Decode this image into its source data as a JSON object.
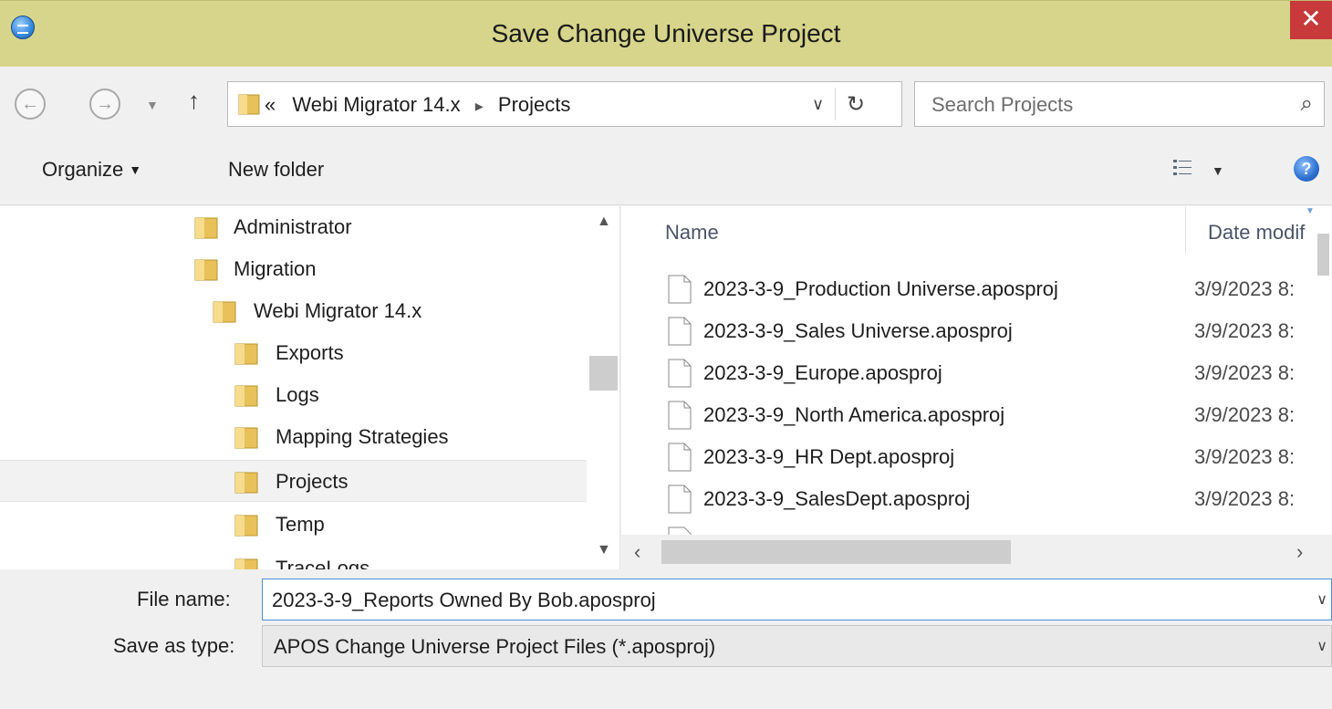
{
  "window": {
    "title": "Save Change Universe Project",
    "close_glyph": "✕"
  },
  "address_bar": {
    "prefix": "«",
    "segments": [
      "Webi Migrator 14.x",
      "Projects"
    ],
    "separator": "▸",
    "search_placeholder": "Search Projects"
  },
  "toolbar": {
    "organize_label": "Organize",
    "new_folder_label": "New folder",
    "help_glyph": "?"
  },
  "navigation_tree": {
    "items": [
      {
        "label": "Administrator",
        "level": 0,
        "selected": false
      },
      {
        "label": "Migration",
        "level": 0,
        "selected": false
      },
      {
        "label": "Webi Migrator 14.x",
        "level": 1,
        "selected": false
      },
      {
        "label": "Exports",
        "level": 2,
        "selected": false
      },
      {
        "label": "Logs",
        "level": 2,
        "selected": false
      },
      {
        "label": "Mapping Strategies",
        "level": 2,
        "selected": false
      },
      {
        "label": "Projects",
        "level": 2,
        "selected": true
      },
      {
        "label": "Temp",
        "level": 2,
        "selected": false
      },
      {
        "label": "TraceLogs",
        "level": 2,
        "selected": false
      }
    ]
  },
  "file_list": {
    "columns": [
      "Name",
      "Date modif"
    ],
    "rows": [
      {
        "name": "2023-3-9_Production Universe.aposproj",
        "date": "3/9/2023 8:"
      },
      {
        "name": "2023-3-9_Sales Universe.aposproj",
        "date": "3/9/2023 8:"
      },
      {
        "name": "2023-3-9_Europe.aposproj",
        "date": "3/9/2023 8:"
      },
      {
        "name": "2023-3-9_North America.aposproj",
        "date": "3/9/2023 8:"
      },
      {
        "name": "2023-3-9_HR Dept.aposproj",
        "date": "3/9/2023 8:"
      },
      {
        "name": "2023-3-9_SalesDept.aposproj",
        "date": "3/9/2023 8:"
      }
    ]
  },
  "form": {
    "file_name_label": "File name:",
    "file_name_value": "2023-3-9_Reports Owned By Bob.aposproj",
    "save_as_type_label": "Save as type:",
    "save_as_type_value": "APOS Change Universe Project Files (*.aposproj)"
  },
  "colors": {
    "titlebar": "#d6d58b",
    "close": "#c7393a",
    "folder": "#e8c15a",
    "focus_border": "#4a90d9"
  }
}
